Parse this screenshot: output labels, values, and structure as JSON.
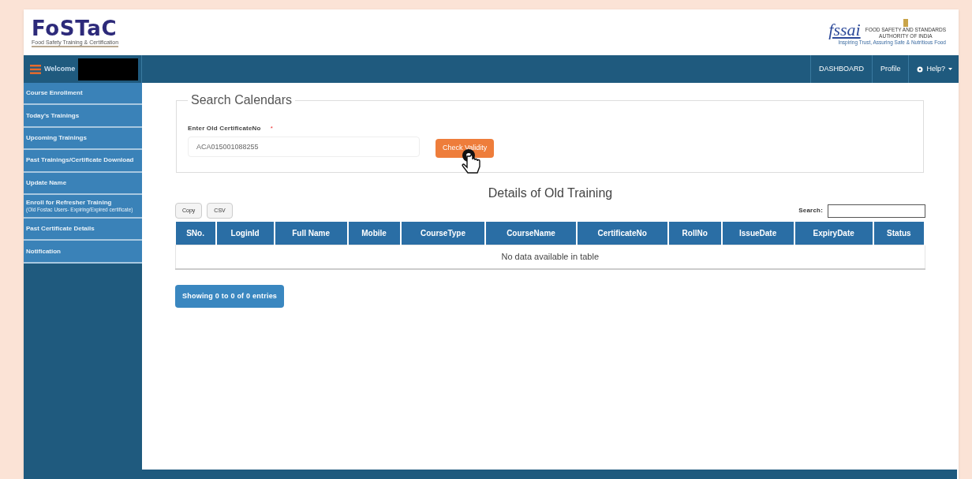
{
  "header": {
    "logo_title": "FoSTaC",
    "logo_subtitle": "Food Safety Training & Certification",
    "partner_logo": "fssai",
    "partner_name_line1": "FOOD SAFETY AND STANDARDS",
    "partner_name_line2": "AUTHORITY OF INDIA",
    "partner_tagline": "Inspiring Trust, Assuring Safe & Nutritious Food"
  },
  "navbar": {
    "welcome": "Welcome",
    "links": [
      {
        "label": "DASHBOARD",
        "kind": "link"
      },
      {
        "label": "Profile",
        "kind": "link"
      },
      {
        "label": "Help?",
        "kind": "dropdown"
      }
    ]
  },
  "sidebar": {
    "items": [
      {
        "label": "Course Enrollment"
      },
      {
        "label": "Today's Trainings"
      },
      {
        "label": "Upcoming Trainings"
      },
      {
        "label": "Past Trainings/Certificate Download"
      },
      {
        "label": "Update Name"
      },
      {
        "label": "Enroll for Refresher Training",
        "sublabel": "(Old Fostac Users- Expiring/Expired certificate)"
      },
      {
        "label": "Past Certificate Details"
      },
      {
        "label": "Notification"
      }
    ]
  },
  "search_panel": {
    "legend": "Search Calendars",
    "field_label": "Enter Old CertificateNo",
    "required_mark": "*",
    "value": "ACA015001088255",
    "button": "Check Validity"
  },
  "table_section": {
    "title": "Details of Old Training",
    "export_buttons": [
      "Copy",
      "CSV"
    ],
    "search_label": "Search:",
    "columns": [
      "SNo.",
      "LoginId",
      "Full Name",
      "Mobile",
      "CourseType",
      "CourseName",
      "CertificateNo",
      "RollNo",
      "IssueDate",
      "ExpiryDate",
      "Status"
    ],
    "empty_message": "No data available in table",
    "info": "Showing 0 to 0 of 0 entries"
  }
}
